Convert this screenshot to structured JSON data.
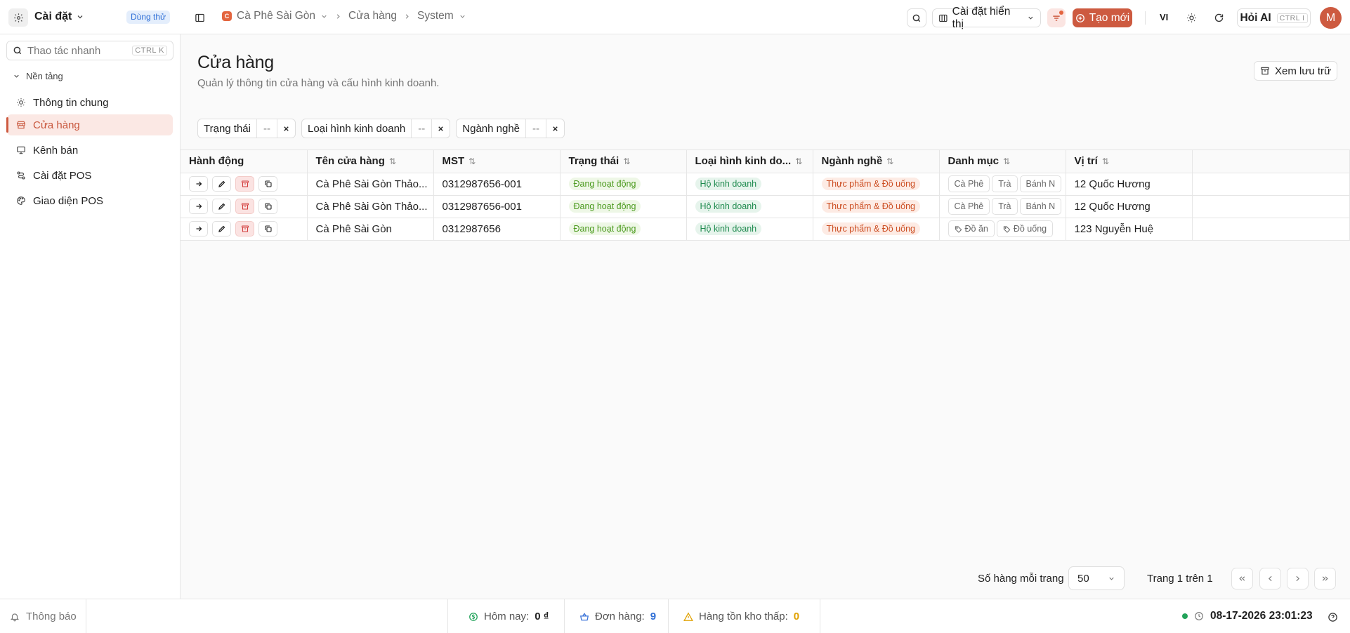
{
  "app": {
    "title": "Cài đặt",
    "trial_badge": "Dùng thử"
  },
  "breadcrumb": {
    "store": "Cà Phê Sài Gòn",
    "store_initial": "C",
    "section": "Cửa hàng",
    "current": "System"
  },
  "toolbar": {
    "display_settings": "Cài đặt hiển thị",
    "create_new": "Tạo mới",
    "language": "VI",
    "ask_ai": "Hỏi AI",
    "ask_ai_shortcut": "CTRL I",
    "avatar_initial": "M"
  },
  "sidebar": {
    "quick_search_placeholder": "Thao tác nhanh",
    "quick_search_shortcut": "CTRL K",
    "group_title": "Nền tảng",
    "items": [
      {
        "label": "Thông tin chung",
        "icon": "sun-icon"
      },
      {
        "label": "Cửa hàng",
        "icon": "store-icon",
        "active": true
      },
      {
        "label": "Kênh bán",
        "icon": "monitor-icon"
      },
      {
        "label": "Cài đặt POS",
        "icon": "route-icon"
      },
      {
        "label": "Giao diện POS",
        "icon": "palette-icon"
      }
    ]
  },
  "page": {
    "title": "Cửa hàng",
    "subtitle": "Quản lý thông tin cửa hàng và cấu hình kinh doanh.",
    "archive_button": "Xem lưu trữ"
  },
  "filters": [
    {
      "label": "Trạng thái",
      "value": "--"
    },
    {
      "label": "Loại hình kinh doanh",
      "value": "--"
    },
    {
      "label": "Ngành nghề",
      "value": "--"
    }
  ],
  "table": {
    "columns": [
      "Hành động",
      "Tên cửa hàng",
      "MST",
      "Trạng thái",
      "Loại hình kinh do...",
      "Ngành nghề",
      "Danh mục",
      "Vị trí"
    ],
    "rows": [
      {
        "name": "Cà Phê Sài Gòn Thảo...",
        "tax_id": "0312987656-001",
        "status": "Đang hoạt động",
        "business_type": "Hộ kinh doanh",
        "industry": "Thực phẩm & Đồ uống",
        "categories": [
          "Cà Phê",
          "Trà",
          "Bánh N"
        ],
        "location": "12 Quốc Hương"
      },
      {
        "name": "Cà Phê Sài Gòn Thảo...",
        "tax_id": "0312987656-001",
        "status": "Đang hoạt động",
        "business_type": "Hộ kinh doanh",
        "industry": "Thực phẩm & Đồ uống",
        "categories": [
          "Cà Phê",
          "Trà",
          "Bánh N"
        ],
        "location": "12 Quốc Hương"
      },
      {
        "name": "Cà Phê Sài Gòn",
        "tax_id": "0312987656",
        "status": "Đang hoạt động",
        "business_type": "Hộ kinh doanh",
        "industry": "Thực phẩm & Đồ uống",
        "categories": [
          "Đồ ăn",
          "Đồ uống"
        ],
        "location": "123 Nguyễn Huệ"
      }
    ]
  },
  "pagination": {
    "rows_per_page_label": "Số hàng mỗi trang",
    "rows_per_page": "50",
    "page_info": "Trang 1 trên 1"
  },
  "statusbar": {
    "notifications": "Thông báo",
    "today_label": "Hôm nay:",
    "today_value": "0 ₫",
    "orders_label": "Đơn hàng:",
    "orders_value": "9",
    "low_stock_label": "Hàng tồn kho thấp:",
    "low_stock_value": "0",
    "datetime": "08-17-2026 23:01:23"
  },
  "colors": {
    "accent": "#cd5a40",
    "active_bg": "#fbe8e4",
    "trial_badge": "#2f6fd6"
  }
}
